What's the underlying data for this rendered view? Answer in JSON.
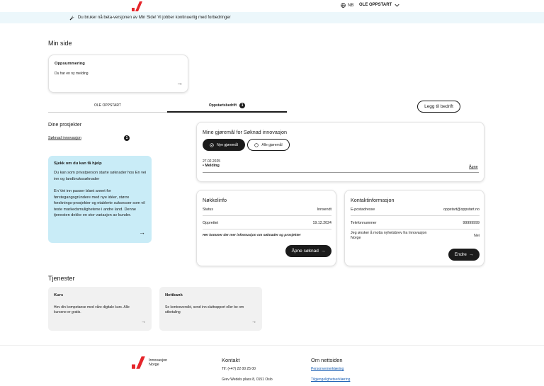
{
  "header": {
    "language": "NB",
    "user_name": "OLE OPPSTART"
  },
  "beta_banner": {
    "text": "Du bruker nå beta-versjonen av Min Side! Vi jobber kontinuerlig med forbedringer"
  },
  "page_title": "Min side",
  "summary_card": {
    "title": "Oppsummering",
    "text": "Du har en ny melding"
  },
  "tabs": [
    {
      "label": "OLE OPPSTART",
      "active": false
    },
    {
      "label": "Oppstartsbedrift",
      "active": true,
      "badge": "1"
    }
  ],
  "add_company_label": "Legg til bedrift",
  "projects": {
    "heading": "Dine prosjekter",
    "items": [
      {
        "label": "Søknad innovasjon",
        "badge": "1"
      }
    ]
  },
  "help_box": {
    "title": "Sjekk om du kan få hjelp",
    "p1": "Du kan som privatperson starte søknader hos En vei inn og landbrukssøknader",
    "p2": "En Vei inn passer blant annet for førstegangsgründere med nye idéer, større forsknings-prosjekter og etablerte suksesser som vil teste markedsmulighetene i andre land. Denne tjenesten dekke en stor variasjon av kunder."
  },
  "tasks": {
    "title": "Mine gjøremål for Søknad innovasjon",
    "filter_new": "Nye gjøremål",
    "filter_all": "Alle gjøremål",
    "item_date": "27.02.2025",
    "item_label": "Melding",
    "item_link": "Åpne"
  },
  "key_info": {
    "title": "Nøkkelinfo",
    "rows": [
      {
        "label": "Status",
        "value": "Innsendt"
      },
      {
        "label": "Opprettet",
        "value": "19.12.2024"
      }
    ],
    "note": "Her kommer der mer informasjon om søknader og prosjekter",
    "button": "Åpne søknad"
  },
  "contact_info": {
    "title": "Kontaktinformasjon",
    "rows": [
      {
        "label": "E-postadresse",
        "value": "oppstart@oppstart.no"
      },
      {
        "label": "Telefonnummer",
        "value": "99999999"
      },
      {
        "label": "Jeg ønsker å motta nyhetsbrev fra Innovasjon Norge",
        "value": "Nei"
      }
    ],
    "button": "Endre"
  },
  "services": {
    "heading": "Tjenester",
    "items": [
      {
        "title": "Kurs",
        "text": "Hev din kompetanse med våre digitale kurs. Alle kursene er gratis."
      },
      {
        "title": "Nettbank",
        "text": "Se kontooversikt, send inn sluttrapport eller be om utbetaling"
      }
    ]
  },
  "footer": {
    "logo_line1": "Innovasjon",
    "logo_line2": "Norge",
    "contact_heading": "Kontakt",
    "phone": "Tlf: (+47) 22 00 25 00",
    "address": "Grev Wedels plass 8, 0151 Oslo",
    "about_heading": "Om nettsiden",
    "privacy": "Personvernerklæring",
    "accessibility": "Tilgjengelighetserklæring"
  },
  "colors": {
    "brand_red": "#e5262b",
    "beta_bg": "#ecf7fb",
    "help_bg": "#c9ecf7"
  }
}
